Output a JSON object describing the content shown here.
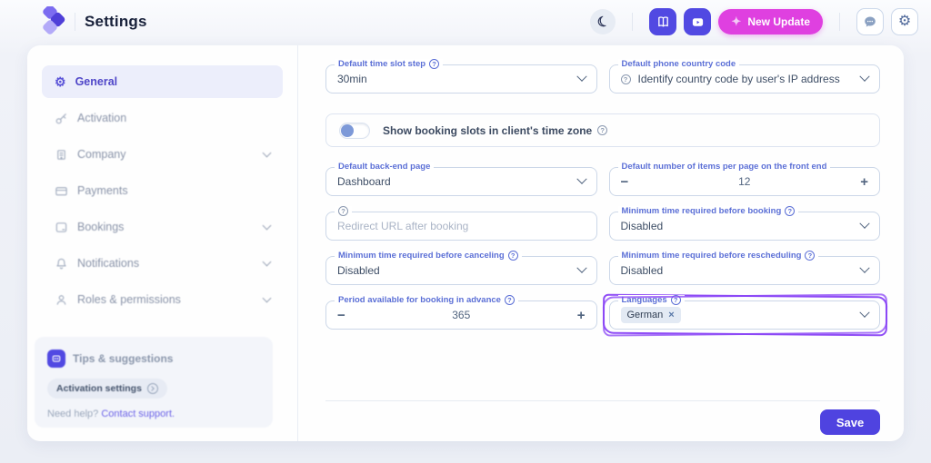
{
  "header": {
    "title": "Settings",
    "new_update_label": "New Update"
  },
  "icons": {
    "moon": "☾",
    "gear": "⚙",
    "star": "✦",
    "help": "?",
    "minus": "−",
    "plus": "+",
    "close": "×"
  },
  "sidebar": {
    "items": [
      {
        "label": "General"
      },
      {
        "label": "Activation"
      },
      {
        "label": "Company"
      },
      {
        "label": "Payments"
      },
      {
        "label": "Bookings"
      },
      {
        "label": "Notifications"
      },
      {
        "label": "Roles & permissions"
      }
    ],
    "tips_panel": {
      "title": "Tips & suggestions",
      "badge": "Activation settings",
      "help_text": "Need help?",
      "help_link": "Contact support."
    }
  },
  "form": {
    "time_slot": {
      "label": "Default time slot step",
      "value": "30min"
    },
    "phone_code": {
      "label": "Default phone country code",
      "value": "Identify country code by user's IP address"
    },
    "timezone_toggle": {
      "label": "Show booking slots in client's time zone"
    },
    "backend_page": {
      "label": "Default back-end page",
      "value": "Dashboard"
    },
    "items_per_page": {
      "label": "Default number of items per page on the front end",
      "value": "12"
    },
    "redirect_url": {
      "placeholder": "Redirect URL after booking"
    },
    "min_before_booking": {
      "label": "Minimum time required before booking",
      "value": "Disabled"
    },
    "min_before_canceling": {
      "label": "Minimum time required before canceling",
      "value": "Disabled"
    },
    "min_before_rescheduling": {
      "label": "Minimum time required before rescheduling",
      "value": "Disabled"
    },
    "booking_advance": {
      "label": "Period available for booking in advance",
      "value": "365"
    },
    "languages": {
      "label": "Languages",
      "tag": "German"
    },
    "save_label": "Save"
  },
  "colors": {
    "accent": "#5149e2",
    "magenta": "#df40e0",
    "highlight": "#8a45f5",
    "label": "#5b6fd6"
  }
}
